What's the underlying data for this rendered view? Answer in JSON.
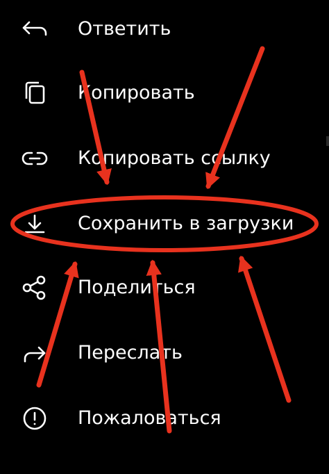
{
  "menu": {
    "items": [
      {
        "label": "Ответить",
        "icon": "reply-icon"
      },
      {
        "label": "Копировать",
        "icon": "copy-icon"
      },
      {
        "label": "Копировать ссылку",
        "icon": "link-icon"
      },
      {
        "label": "Сохранить в загрузки",
        "icon": "download-icon"
      },
      {
        "label": "Поделиться",
        "icon": "share-icon"
      },
      {
        "label": "Переслать",
        "icon": "forward-icon"
      },
      {
        "label": "Пожаловаться",
        "icon": "report-icon"
      }
    ]
  },
  "annotation": {
    "color": "#e8321e",
    "highlighted_item": "Сохранить в загрузки"
  },
  "colors": {
    "background": "#000000",
    "text": "#ffffff"
  }
}
